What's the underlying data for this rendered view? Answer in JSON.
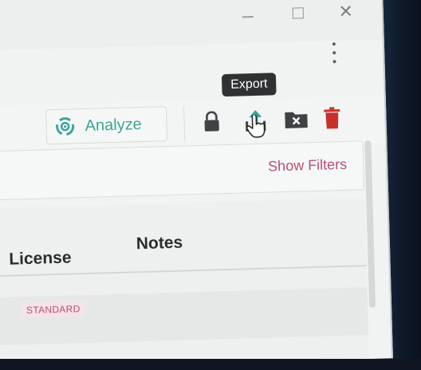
{
  "window": {
    "minimize_icon": "minimize-icon",
    "maximize_icon": "maximize-icon",
    "close_glyph": "✕"
  },
  "toolbar": {
    "analyze_label": "Analyze",
    "tooltip": "Export",
    "icons": [
      "analyze-icon",
      "lock-icon",
      "export-icon",
      "delete-folder-icon",
      "trash-icon",
      "more-icon"
    ]
  },
  "filters": {
    "show_label": "Show Filters"
  },
  "table": {
    "columns": [
      "License",
      "Notes"
    ],
    "rows": [
      {
        "license": "STANDARD",
        "notes": ""
      }
    ]
  },
  "colors": {
    "accent": "#3ba598",
    "link": "#b9506f",
    "danger": "#c8302a",
    "icon_dark": "#3f4345"
  }
}
